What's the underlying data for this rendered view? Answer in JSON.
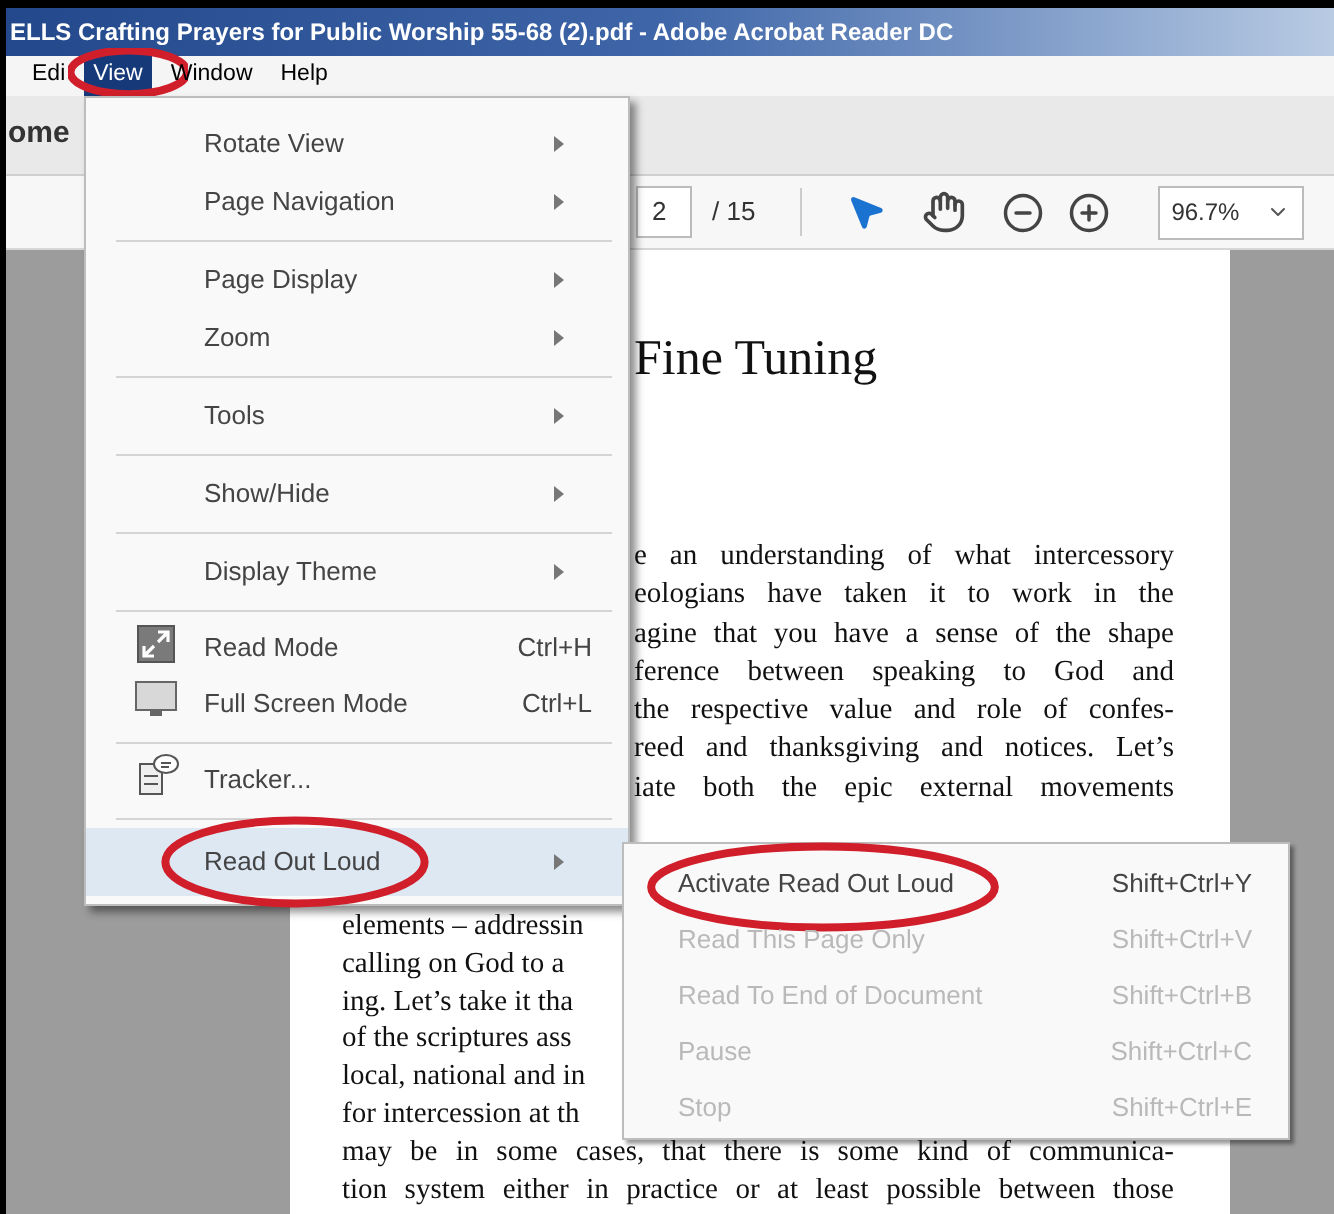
{
  "window": {
    "title": "ELLS Crafting Prayers for Public Worship 55-68 (2).pdf - Adobe Acrobat Reader DC"
  },
  "menu_bar": [
    {
      "label": "Edi",
      "selected": false,
      "circled": false
    },
    {
      "label": "View",
      "selected": true,
      "circled": true
    },
    {
      "label": "Window",
      "selected": false,
      "circled": false
    },
    {
      "label": "Help",
      "selected": false,
      "circled": false
    }
  ],
  "tab": {
    "label": "ome"
  },
  "toolbar": {
    "page": "2",
    "page_count": "/ 15",
    "zoom": "96.7%"
  },
  "view_menu": [
    {
      "kind": "item",
      "label": "Rotate View",
      "submenu": true,
      "selected": false,
      "circled": false
    },
    {
      "kind": "item",
      "label": "Page Navigation",
      "submenu": true,
      "selected": false,
      "circled": false
    },
    {
      "kind": "separator"
    },
    {
      "kind": "item",
      "label": "Page Display",
      "submenu": true,
      "selected": false,
      "circled": false
    },
    {
      "kind": "item",
      "label": "Zoom",
      "submenu": true,
      "selected": false,
      "circled": false
    },
    {
      "kind": "separator"
    },
    {
      "kind": "item",
      "label": "Tools",
      "submenu": true,
      "selected": false,
      "circled": false
    },
    {
      "kind": "separator"
    },
    {
      "kind": "item",
      "label": "Show/Hide",
      "submenu": true,
      "selected": false,
      "circled": false
    },
    {
      "kind": "separator"
    },
    {
      "kind": "item",
      "label": "Display Theme",
      "submenu": true,
      "selected": false,
      "circled": false
    },
    {
      "kind": "separator"
    },
    {
      "kind": "icon-item",
      "label": "Read Mode",
      "shortcut": "Ctrl+H",
      "submenu": false,
      "selected": false,
      "circled": false
    },
    {
      "kind": "icon-item",
      "label": "Full Screen Mode",
      "shortcut": "Ctrl+L",
      "submenu": false,
      "selected": false,
      "circled": false
    },
    {
      "kind": "separator"
    },
    {
      "kind": "icon-item",
      "label": "Tracker...",
      "submenu": false,
      "selected": false,
      "circled": false
    },
    {
      "kind": "separator"
    },
    {
      "kind": "item",
      "label": "Read Out Loud",
      "submenu": true,
      "selected": true,
      "circled": true
    }
  ],
  "read_out_loud_submenu": [
    {
      "label": "Activate Read Out Loud",
      "shortcut": "Shift+Ctrl+Y",
      "disabled": false,
      "circled": true
    },
    {
      "label": "Read This Page Only",
      "shortcut": "Shift+Ctrl+V",
      "disabled": true,
      "circled": false
    },
    {
      "label": "Read To End of Document",
      "shortcut": "Shift+Ctrl+B",
      "disabled": true,
      "circled": false
    },
    {
      "label": "Pause",
      "shortcut": "Shift+Ctrl+C",
      "disabled": true,
      "circled": false
    },
    {
      "label": "Stop",
      "shortcut": "Shift+Ctrl+E",
      "disabled": true,
      "circled": false
    }
  ],
  "document": {
    "heading": "Fine Tuning",
    "upper_lines": [
      "e an understanding of what intercessory",
      "eologians have taken it to work in the",
      "agine that you have a sense of the shape",
      "ference between speaking to God and",
      "the respective value and role of confes-",
      "reed and thanksgiving and notices. Let’s",
      "iate both the epic external movements"
    ],
    "lower_fragments": [
      "elements – addressin",
      "calling on God to a",
      "ing. Let’s take it tha",
      "of the scriptures ass",
      "local, national and in",
      "for intercession at th"
    ],
    "lower_lines": [
      "may be in some cases, that there is some kind of communica-",
      "tion system either in practice or at least possible between those"
    ]
  }
}
